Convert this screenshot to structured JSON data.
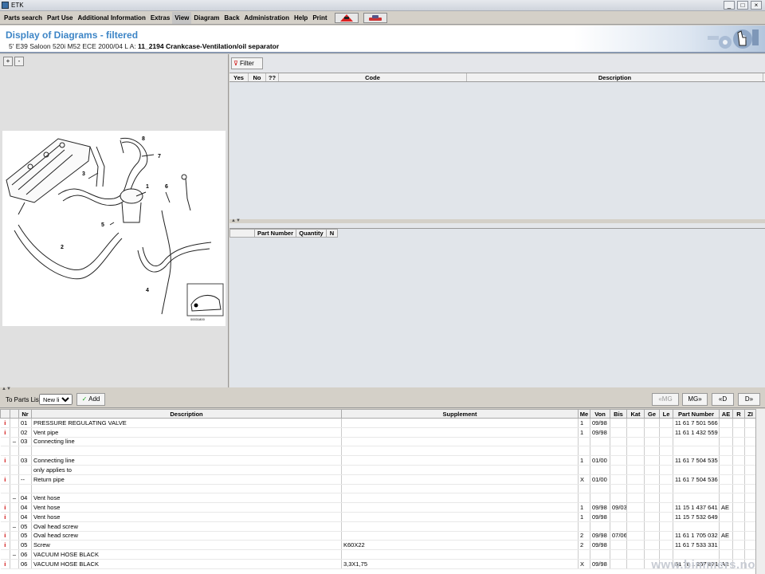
{
  "window": {
    "title": "ETK"
  },
  "menu": [
    "Parts search",
    "Part Use",
    "Additional Information",
    "Extras",
    "View",
    "Diagram",
    "Back",
    "Administration",
    "Help",
    "Print"
  ],
  "header": {
    "title": "Display of Diagrams - filtered",
    "vehicle": "5' E39 Saloon 520i M52 ECE 2000/04 L A: ",
    "diagram": "11_2194 Crankcase-Ventilation/oil separator"
  },
  "left": {
    "zoom_in": "+",
    "zoom_out": "-"
  },
  "diagram": {
    "callouts": [
      "1",
      "2",
      "3",
      "4",
      "5",
      "6",
      "7",
      "8"
    ],
    "image_number": "00031800"
  },
  "right": {
    "filter_label": "Filter",
    "grid1_columns": [
      "Yes",
      "No",
      "??",
      "Code",
      "Description"
    ],
    "grid2_columns": [
      "",
      "Part Number",
      "Quantity",
      "N"
    ]
  },
  "toolbar": {
    "to_parts_list": "To Parts List",
    "list_value": "New list",
    "add_label": "Add",
    "nav": [
      "«MG",
      "MG»",
      "«D",
      "D»"
    ]
  },
  "table": {
    "columns": [
      "",
      "",
      "Nr",
      "Description",
      "Supplement",
      "Me",
      "Von",
      "Bis",
      "Kat",
      "Ge",
      "Le",
      "Part Number",
      "AE",
      "R",
      "ZI"
    ],
    "rows": [
      [
        "i",
        "",
        "01",
        "PRESSURE REGULATING VALVE",
        "",
        "1",
        "09/98",
        "",
        "",
        "",
        "",
        "11 61 7 501 566",
        "",
        "",
        ""
      ],
      [
        "i",
        "",
        "02",
        "Vent pipe",
        "",
        "1",
        "09/98",
        "",
        "",
        "",
        "",
        "11 61 1 432 559",
        "",
        "",
        ""
      ],
      [
        "",
        "–",
        "03",
        "Connecting line",
        "",
        "",
        "",
        "",
        "",
        "",
        "",
        "",
        "",
        "",
        ""
      ],
      [
        "",
        "",
        "",
        "",
        "",
        "",
        "",
        "",
        "",
        "",
        "",
        "",
        "",
        "",
        ""
      ],
      [
        "i",
        "",
        "03",
        "Connecting line",
        "",
        "1",
        "01/00",
        "",
        "",
        "",
        "",
        "11 61 7 504 535",
        "",
        "",
        ""
      ],
      [
        "",
        "",
        "",
        "only applies to",
        "",
        "",
        "",
        "",
        "",
        "",
        "",
        "",
        "",
        "",
        ""
      ],
      [
        "i",
        "",
        "--",
        "Return pipe",
        "",
        "X",
        "01/00",
        "",
        "",
        "",
        "",
        "11 61 7 504 536",
        "",
        "",
        ""
      ],
      [
        "",
        "",
        "",
        "",
        "",
        "",
        "",
        "",
        "",
        "",
        "",
        "",
        "",
        "",
        ""
      ],
      [
        "",
        "–",
        "04",
        "Vent hose",
        "",
        "",
        "",
        "",
        "",
        "",
        "",
        "",
        "",
        "",
        ""
      ],
      [
        "i",
        "",
        "04",
        "Vent hose",
        "",
        "1",
        "09/98",
        "09/03",
        "",
        "",
        "",
        "11 15 1 437 641",
        "AE",
        "",
        ""
      ],
      [
        "i",
        "",
        "04",
        "Vent hose",
        "",
        "1",
        "09/98",
        "",
        "",
        "",
        "",
        "11 15 7 532 649",
        "",
        "",
        ""
      ],
      [
        "",
        "–",
        "05",
        "Oval head screw",
        "",
        "",
        "",
        "",
        "",
        "",
        "",
        "",
        "",
        "",
        ""
      ],
      [
        "i",
        "",
        "05",
        "Oval head screw",
        "",
        "2",
        "09/98",
        "07/06",
        "",
        "",
        "",
        "11 61 1 705 032",
        "AE",
        "",
        ""
      ],
      [
        "i",
        "",
        "05",
        "Screw",
        "K60X22",
        "2",
        "09/98",
        "",
        "",
        "",
        "",
        "11 61 7 533 331",
        "",
        "",
        ""
      ],
      [
        "",
        "–",
        "06",
        "VACUUM HOSE BLACK",
        "",
        "",
        "",
        "",
        "",
        "",
        "",
        "",
        "",
        "",
        ""
      ],
      [
        "i",
        "",
        "06",
        "VACUUM HOSE BLACK",
        "3,3X1,75",
        "X",
        "09/98",
        "",
        "",
        "",
        "",
        "51 78 1 257 871",
        "AE",
        "",
        ""
      ]
    ]
  },
  "watermark": "www.bimmers.no",
  "colors": {
    "title": "#3d85c6",
    "info": "#cc0000"
  }
}
